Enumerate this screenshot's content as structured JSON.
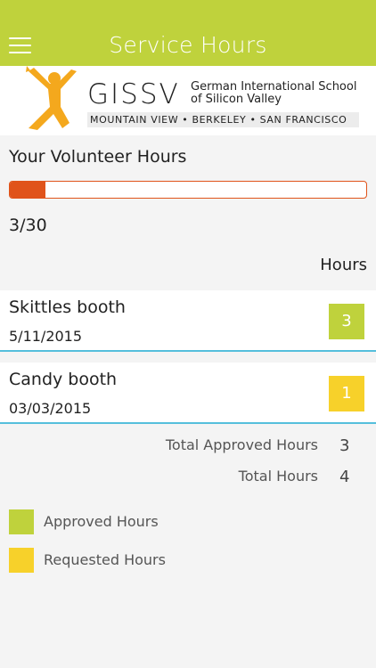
{
  "header": {
    "title": "Service Hours",
    "menu_icon": "hamburger-menu-icon",
    "background": "#bfd23c"
  },
  "logo": {
    "acronym": "GISSV",
    "school_name_line1": "German International School",
    "school_name_line2": "of Silicon Valley",
    "locations": "MOUNTAIN VIEW  •  BERKELEY  •  SAN FRANCISCO"
  },
  "volunteer": {
    "title": "Your Volunteer Hours",
    "progress_text": "3/30",
    "progress_fraction": 0.1,
    "progress_color": "#e0531a",
    "hours_header": "Hours"
  },
  "entries": [
    {
      "name": "Skittles booth",
      "date": "5/11/2015",
      "hours": "3",
      "status": "approved"
    },
    {
      "name": "Candy booth",
      "date": "03/03/2015",
      "hours": "1",
      "status": "requested"
    }
  ],
  "totals": {
    "approved_label": "Total Approved Hours",
    "approved_value": "3",
    "total_label": "Total  Hours",
    "total_value": "4"
  },
  "legend": {
    "approved_label": "Approved Hours",
    "approved_color": "#bfd23c",
    "requested_label": "Requested Hours",
    "requested_color": "#f7d12a"
  }
}
